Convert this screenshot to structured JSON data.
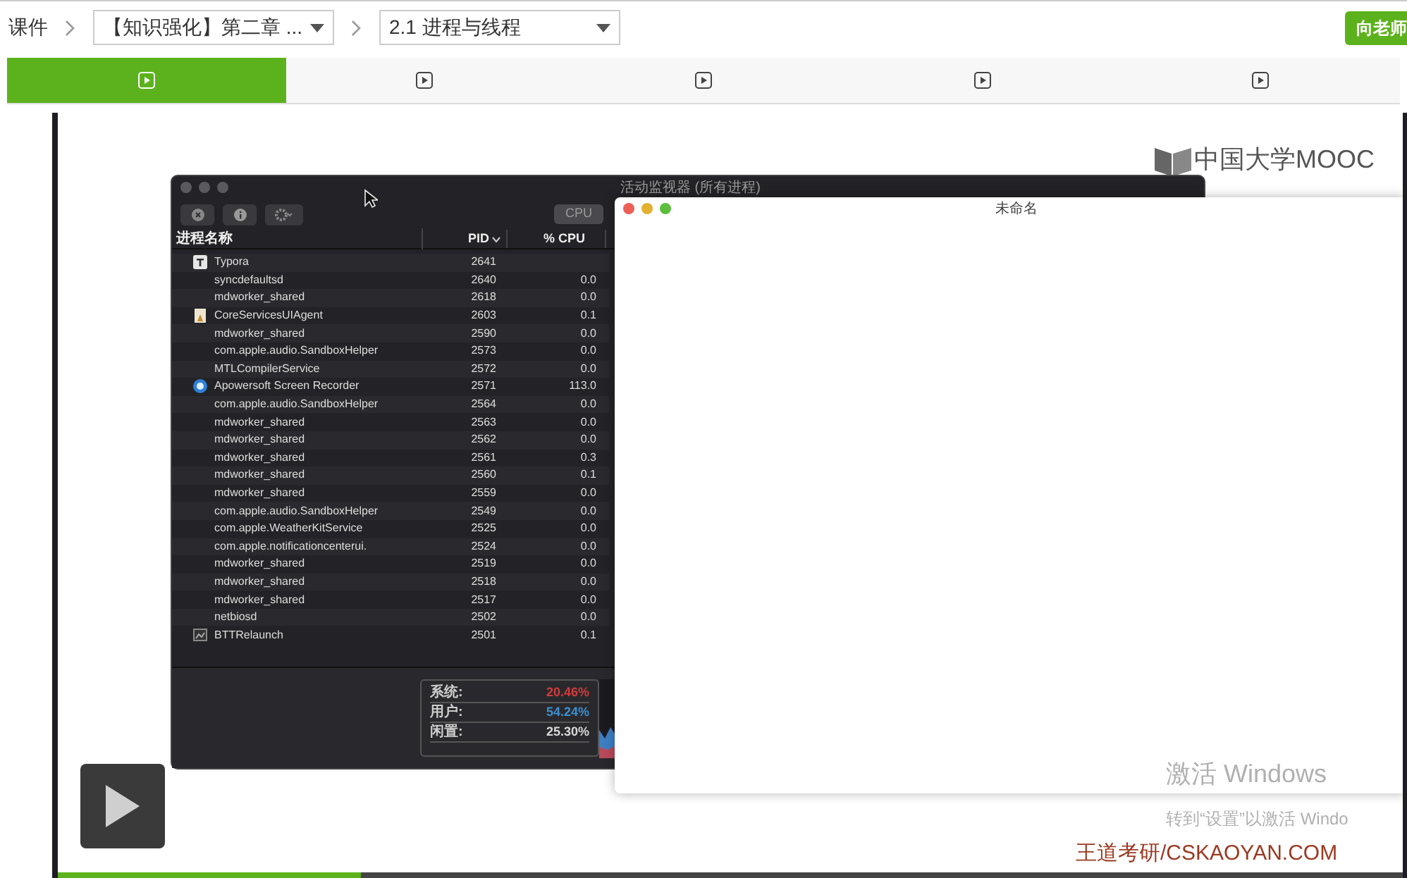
{
  "breadcrumb": {
    "root": "课件",
    "chapter": "【知识强化】第二章 ...",
    "section": "2.1 进程与线程"
  },
  "ask_button": "向老师",
  "tabs": [
    {
      "selected": true
    },
    {
      "selected": false
    },
    {
      "selected": false
    },
    {
      "selected": false
    },
    {
      "selected": false
    }
  ],
  "video": {
    "logo": "中国大学MOOC",
    "watermark": "王道考研/CSKAOYAN.COM",
    "activation": {
      "title": "激活 Windows",
      "hint": "转到“设置”以激活 Windo"
    },
    "progress": {
      "level": 0.225
    },
    "activity_monitor": {
      "title": "活动监视器 (所有进程)",
      "segments": [
        {
          "label": "CPU",
          "selected": true
        }
      ],
      "columns": [
        "进程名称",
        "PID",
        "% CPU"
      ],
      "rows": [
        {
          "kind": "letter",
          "name": "Typora",
          "pid": "2641",
          "cpu": ""
        },
        {
          "kind": "plain",
          "name": "syncdefaultsd",
          "pid": "2640",
          "cpu": "0.0"
        },
        {
          "kind": "plain",
          "name": "mdworker_shared",
          "pid": "2618",
          "cpu": "0.0"
        },
        {
          "kind": "document",
          "name": "CoreServicesUIAgent",
          "pid": "2603",
          "cpu": "0.1"
        },
        {
          "kind": "plain",
          "name": "mdworker_shared",
          "pid": "2590",
          "cpu": "0.0"
        },
        {
          "kind": "plain",
          "name": "com.apple.audio.SandboxHelper",
          "pid": "2573",
          "cpu": "0.0"
        },
        {
          "kind": "plain",
          "name": "MTLCompilerService",
          "pid": "2572",
          "cpu": "0.0"
        },
        {
          "kind": "globe",
          "name": "Apowersoft Screen Recorder",
          "pid": "2571",
          "cpu": "113.0"
        },
        {
          "kind": "plain",
          "name": "com.apple.audio.SandboxHelper",
          "pid": "2564",
          "cpu": "0.0"
        },
        {
          "kind": "plain",
          "name": "mdworker_shared",
          "pid": "2563",
          "cpu": "0.0"
        },
        {
          "kind": "plain",
          "name": "mdworker_shared",
          "pid": "2562",
          "cpu": "0.0"
        },
        {
          "kind": "plain",
          "name": "mdworker_shared",
          "pid": "2561",
          "cpu": "0.3"
        },
        {
          "kind": "plain",
          "name": "mdworker_shared",
          "pid": "2560",
          "cpu": "0.1"
        },
        {
          "kind": "plain",
          "name": "mdworker_shared",
          "pid": "2559",
          "cpu": "0.0"
        },
        {
          "kind": "plain",
          "name": "com.apple.audio.SandboxHelper",
          "pid": "2549",
          "cpu": "0.0"
        },
        {
          "kind": "plain",
          "name": "com.apple.WeatherKitService",
          "pid": "2525",
          "cpu": "0.0"
        },
        {
          "kind": "plain",
          "name": "com.apple.notificationcenterui.",
          "pid": "2524",
          "cpu": "0.0"
        },
        {
          "kind": "plain",
          "name": "mdworker_shared",
          "pid": "2519",
          "cpu": "0.0"
        },
        {
          "kind": "plain",
          "name": "mdworker_shared",
          "pid": "2518",
          "cpu": "0.0"
        },
        {
          "kind": "plain",
          "name": "mdworker_shared",
          "pid": "2517",
          "cpu": "0.0"
        },
        {
          "kind": "plain",
          "name": "netbiosd",
          "pid": "2502",
          "cpu": "0.0"
        },
        {
          "kind": "window",
          "name": "BTTRelaunch",
          "pid": "2501",
          "cpu": "0.1"
        }
      ],
      "stats": [
        {
          "label": "系统:",
          "value": "20.46%",
          "color": "#d23b3b"
        },
        {
          "label": "用户:",
          "value": "54.24%",
          "color": "#3d8fd0"
        },
        {
          "label": "闲置:",
          "value": "25.30%",
          "color": "#d8d8d8"
        }
      ]
    },
    "editor_window": {
      "title": "未命名"
    }
  }
}
